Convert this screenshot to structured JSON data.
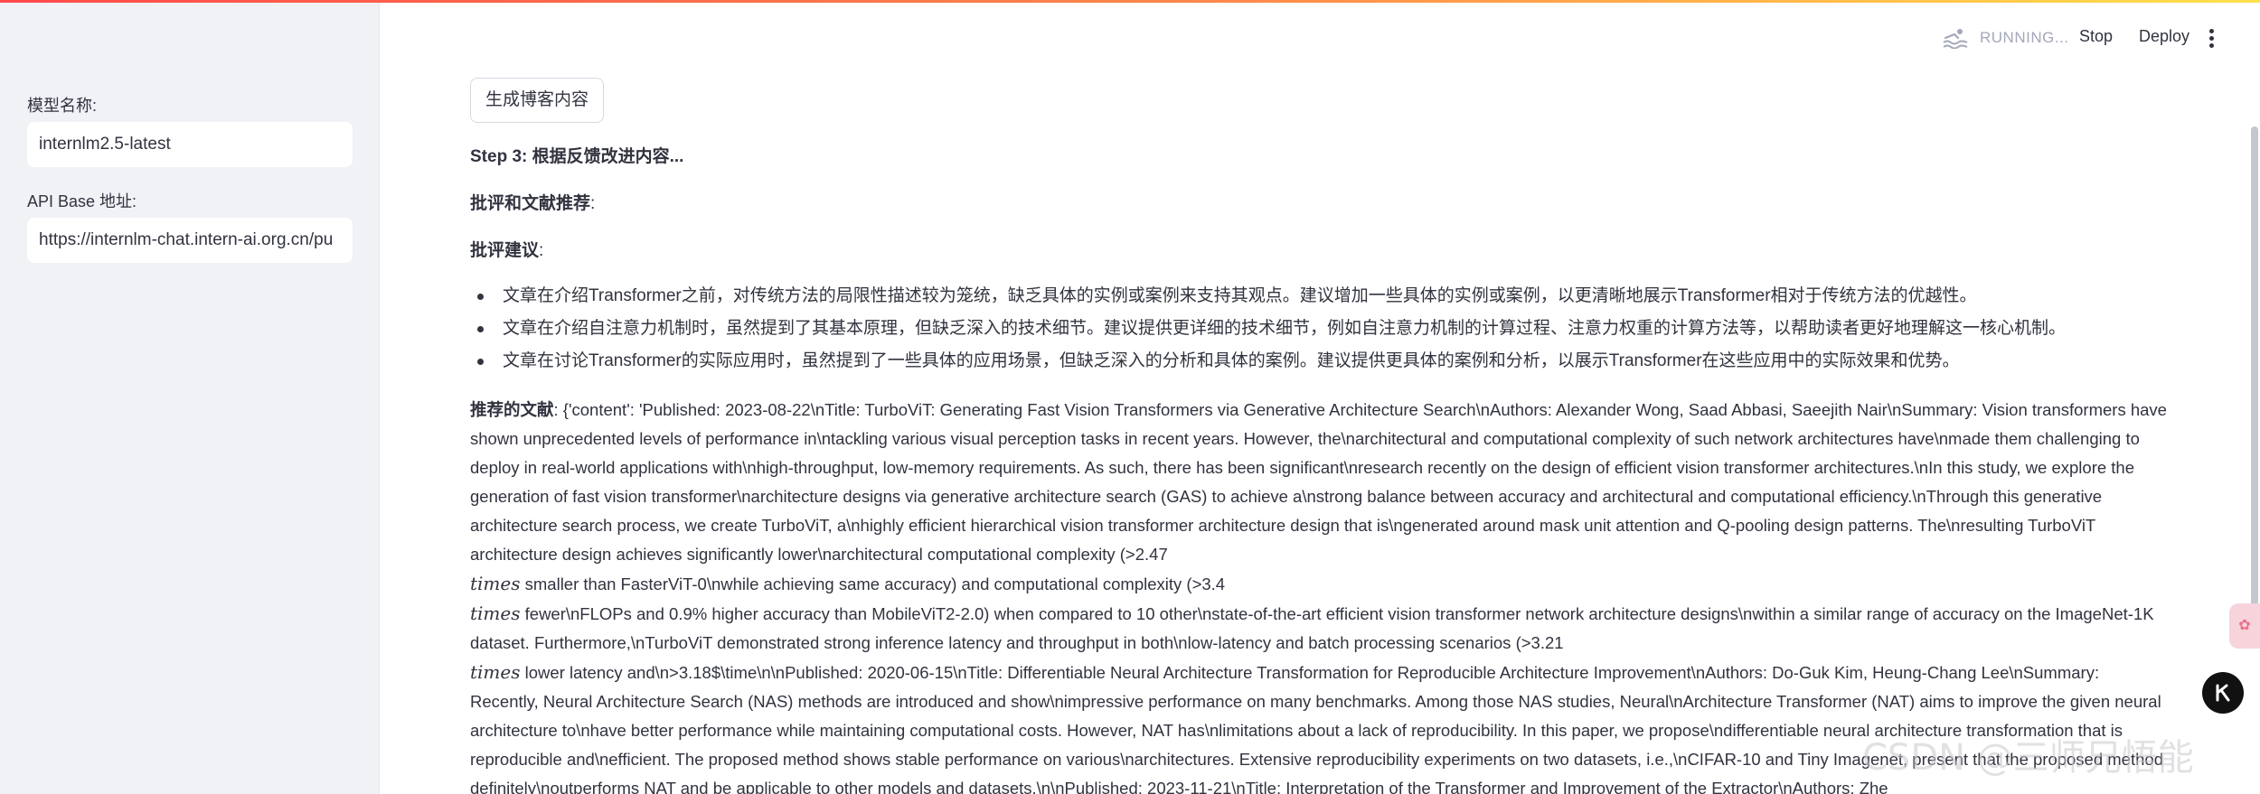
{
  "sidebar": {
    "model_label": "模型名称:",
    "model_value": "internlm2.5-latest",
    "api_label": "API Base 地址:",
    "api_value": "https://internlm-chat.intern-ai.org.cn/pu"
  },
  "header": {
    "status": "RUNNING...",
    "stop_label": "Stop",
    "deploy_label": "Deploy"
  },
  "main": {
    "generate_button": "生成博客内容",
    "step_heading": "Step 3: 根据反馈改进内容...",
    "critique_heading": "批评和文献推荐",
    "suggest_heading": "批评建议",
    "colon": ":",
    "bullets": [
      "文章在介绍Transformer之前，对传统方法的局限性描述较为笼统，缺乏具体的实例或案例来支持其观点。建议增加一些具体的实例或案例，以更清晰地展示Transformer相对于传统方法的优越性。",
      "文章在介绍自注意力机制时，虽然提到了其基本原理，但缺乏深入的技术细节。建议提供更详细的技术细节，例如自注意力机制的计算过程、注意力权重的计算方法等，以帮助读者更好地理解这一核心机制。",
      "文章在讨论Transformer的实际应用时，虽然提到了一些具体的应用场景，但缺乏深入的分析和具体的案例。建议提供更具体的案例和分析，以展示Transformer在这些应用中的实际效果和优势。"
    ],
    "lit_heading": "推荐的文献",
    "lit_part1": ": {'content': 'Published: 2023-08-22\\nTitle: TurboViT: Generating Fast Vision Transformers via Generative Architecture Search\\nAuthors: Alexander Wong, Saad Abbasi, Saeejith Nair\\nSummary: Vision transformers have shown unprecedented levels of performance in\\ntackling various visual perception tasks in recent years. However, the\\narchitectural and computational complexity of such network architectures have\\nmade them challenging to deploy in real-world applications with\\nhigh-throughput, low-memory requirements. As such, there has been significant\\nresearch recently on the design of efficient vision transformer architectures.\\nIn this study, we explore the generation of fast vision transformer\\narchitecture designs via generative architecture search (GAS) to achieve a\\nstrong balance between accuracy and architectural and computational efficiency.\\nThrough this generative architecture search process, we create TurboViT, a\\nhighly efficient hierarchical vision transformer architecture design that is\\ngenerated around mask unit attention and Q-pooling design patterns. The\\nresulting TurboViT architecture design achieves significantly lower\\narchitectural computational complexity (>2.47",
    "math_times": "times",
    "lit_part2": " smaller than FasterViT-0\\nwhile achieving same accuracy) and computational complexity (>3.4",
    "lit_part3": " fewer\\nFLOPs and 0.9% higher accuracy than MobileViT2-2.0) when compared to 10 other\\nstate-of-the-art efficient vision transformer network architecture designs\\nwithin a similar range of accuracy on the ImageNet-1K dataset. Furthermore,\\nTurboViT demonstrated strong inference latency and throughput in both\\nlow-latency and batch processing scenarios (>3.21",
    "lit_part4": " lower latency and\\n>3.18$\\time\\n\\nPublished: 2020-06-15\\nTitle: Differentiable Neural Architecture Transformation for Reproducible Architecture Improvement\\nAuthors: Do-Guk Kim, Heung-Chang Lee\\nSummary: Recently, Neural Architecture Search (NAS) methods are introduced and show\\nimpressive performance on many benchmarks. Among those NAS studies, Neural\\nArchitecture Transformer (NAT) aims to improve the given neural architecture to\\nhave better performance while maintaining computational costs. However, NAT has\\nlimitations about a lack of reproducibility. In this paper, we propose\\ndifferentiable neural architecture transformation that is reproducible and\\nefficient. The proposed method shows stable performance on various\\narchitectures. Extensive reproducibility experiments on two datasets, i.e.,\\nCIFAR-10 and Tiny Imagenet, present that the proposed method definitely\\noutperforms NAT and be applicable to other models and datasets.\\n\\nPublished: 2023-11-21\\nTitle: Interpretation of the Transformer and Improvement of the Extractor\\nAuthors: Zhe"
  },
  "watermark": "CSDN @三师兄悟能",
  "colors": {
    "accent_red": "#ff4b4b",
    "text": "#31333f",
    "sidebar_bg": "#f0f2f6"
  }
}
